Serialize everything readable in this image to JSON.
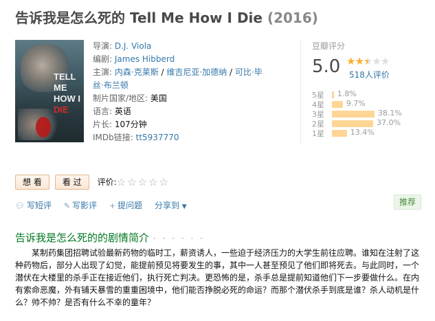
{
  "movie": {
    "title_cn": "告诉我是怎么死的 Tell Me How I Die",
    "year": "(2016)",
    "poster": {
      "line1": "TELL",
      "line2": "ME",
      "line3": "HOW I",
      "line4": "DIE"
    }
  },
  "info": {
    "director_label": "导演:",
    "director": "D.J. Viola",
    "writer_label": "编剧:",
    "writer": "James Hibberd",
    "cast_label": "主演:",
    "cast_1": "内森·克莱斯",
    "cast_sep_1": " / ",
    "cast_2": "维吉尼亚·加德纳",
    "cast_sep_2": " / ",
    "cast_3a": "可比·毕",
    "cast_3b": "丝·布兰顿",
    "country_label": "制片国家/地区:",
    "country": "美国",
    "language_label": "语言:",
    "language": "英语",
    "runtime_label": "片长:",
    "runtime": "107分钟",
    "imdb_label": "IMDb链接:",
    "imdb": "tt5937770"
  },
  "rating": {
    "label": "豆瓣评分",
    "score": "5.0",
    "stars_on": "★★",
    "stars_half": "★",
    "stars_off": "★★",
    "votes": "518人评价",
    "distribution": [
      {
        "label": "5星",
        "pct": "1.8%",
        "value": 1.8
      },
      {
        "label": "4星",
        "pct": "9.7%",
        "value": 9.7
      },
      {
        "label": "3星",
        "pct": "38.1%",
        "value": 38.1
      },
      {
        "label": "2星",
        "pct": "37.0%",
        "value": 37.0
      },
      {
        "label": "1星",
        "pct": "13.4%",
        "value": 13.4
      }
    ]
  },
  "buttons": {
    "want": "想 看",
    "seen": "看 过",
    "rate_label": "评价:",
    "rate_stars": "☆☆☆☆☆"
  },
  "actions": {
    "short_review": "写短评",
    "review": "写影评",
    "ask": "提问题",
    "share": "分享到",
    "share_caret": "▼",
    "recommend": "推荐"
  },
  "synopsis": {
    "title": "告诉我是怎么死的的剧情简介",
    "dots": "· · · · · ·",
    "text": "某制药集团招聘试验最新药物的临时工，薪资诱人，一些迫于经济压力的大学生前往应聘。谁知在注射了这种药物后，部分人出现了幻觉，能提前预见将要发生的事，其中一人甚至预见了他们即将死去。与此同时，一个潜伏在大楼里的杀手正在接近他们，执行死亡判决。更恐怖的是，杀手总是提前知道他们下一步要做什么。在内有索命恶魔，外有铺天暴雪的重重困境中，他们能否挣脱必死的命运？而那个潜伏杀手到底是谁？杀人动机是什么？帅不帅？是否有什么不幸的童年？"
  },
  "colors": {
    "link": "#3377aa",
    "star": "#ffac2d",
    "bar": "#ffd596",
    "section": "#007722"
  }
}
